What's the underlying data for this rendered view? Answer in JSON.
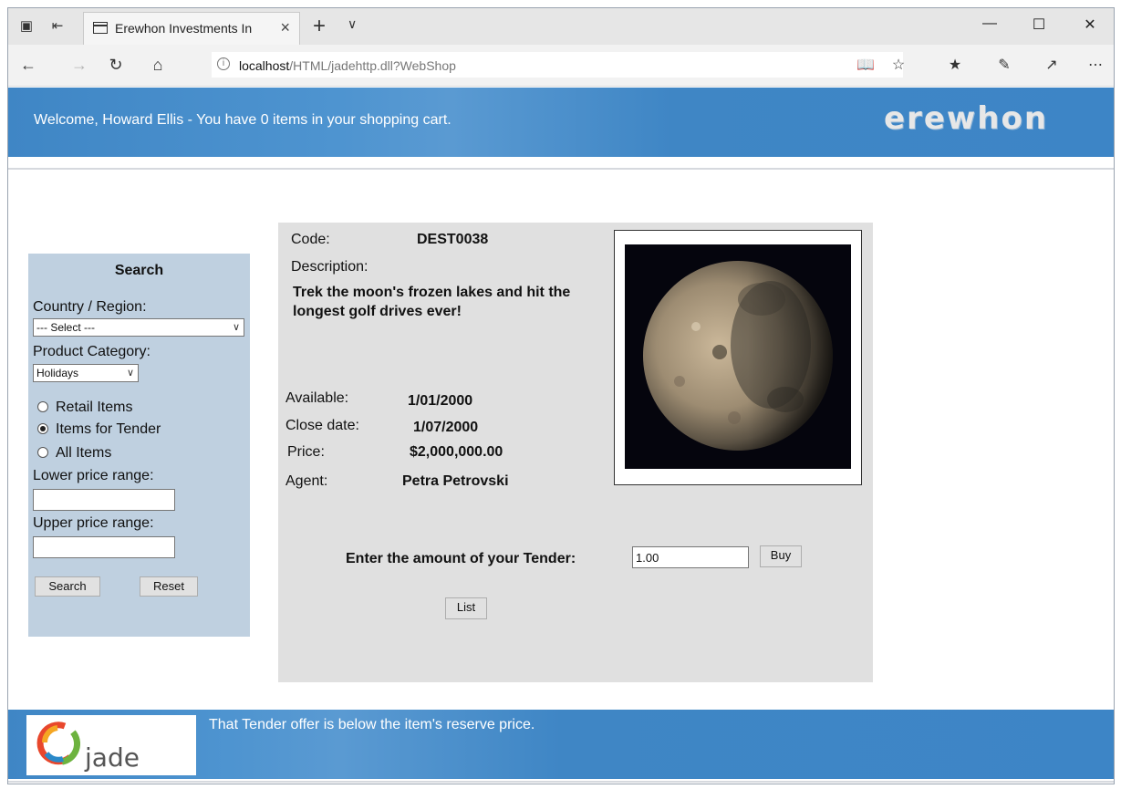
{
  "browser": {
    "tab_title": "Erewhon Investments In",
    "url_host": "localhost",
    "url_path": "/HTML/jadehttp.dll?WebShop"
  },
  "header": {
    "welcome": "Welcome, Howard Ellis - You have 0 items in your shopping cart.",
    "logo": "erewhon"
  },
  "search": {
    "title": "Search",
    "country_label": "Country / Region:",
    "country_value": "--- Select ---",
    "category_label": "Product Category:",
    "category_value": "Holidays",
    "radio_retail": "Retail Items",
    "radio_tender": "Items for Tender",
    "radio_all": "All Items",
    "selected_radio": "Items for Tender",
    "lower_label": "Lower price range:",
    "lower_value": "",
    "upper_label": "Upper price range:",
    "upper_value": "",
    "search_button": "Search",
    "reset_button": "Reset"
  },
  "item": {
    "code_label": "Code:",
    "code": "DEST0038",
    "description_label": "Description:",
    "description": "Trek the moon's frozen lakes and hit the longest golf drives ever!",
    "available_label": "Available:",
    "available": "1/01/2000",
    "close_label": "Close date:",
    "close": "1/07/2000",
    "price_label": "Price:",
    "price": "$2,000,000.00",
    "agent_label": "Agent:",
    "agent": "Petra Petrovski",
    "tender_label": "Enter the amount of your Tender:",
    "tender_value": "1.00",
    "buy_button": "Buy",
    "list_button": "List"
  },
  "footer": {
    "logo_text": "jade",
    "message": "That Tender offer is below the item's reserve price."
  }
}
